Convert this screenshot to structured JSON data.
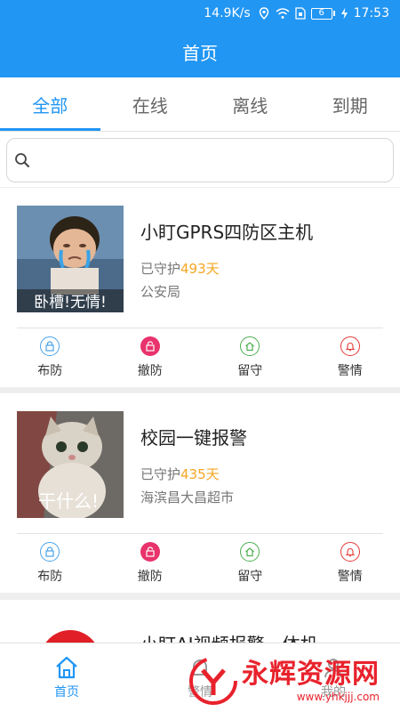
{
  "status": {
    "speed": "14.9K/s",
    "battery": "6",
    "time": "17:53"
  },
  "appbar": {
    "title": "首页"
  },
  "tabs": [
    {
      "label": "全部"
    },
    {
      "label": "在线"
    },
    {
      "label": "离线"
    },
    {
      "label": "到期"
    }
  ],
  "search": {
    "placeholder": "",
    "value": ""
  },
  "devices": [
    {
      "title": "小盯GPRS四防区主机",
      "days_prefix": "已守护",
      "days_value": "493",
      "days_unit": "天",
      "location": "公安局",
      "thumb_caption": "卧槽!无情!"
    },
    {
      "title": "校园一键报警",
      "days_prefix": "已守护",
      "days_value": "435",
      "days_unit": "天",
      "location": "海滨昌大昌超市",
      "thumb_caption": "干什么!"
    },
    {
      "title": "小盯AI视频报警一体机"
    }
  ],
  "actions": {
    "arm": "布防",
    "disarm": "撤防",
    "stay": "留守",
    "alarm": "警情"
  },
  "bottom_nav": [
    {
      "label": "首页"
    },
    {
      "label": "警情"
    },
    {
      "label": "我的"
    }
  ],
  "watermark": {
    "title": "永辉资源网",
    "url": "www.yhkjjj.com"
  },
  "colors": {
    "primary": "#2196f3",
    "days_highlight": "#f5a623",
    "disarm": "#e8336d",
    "stay": "#4caf50",
    "alarm": "#e53935"
  }
}
